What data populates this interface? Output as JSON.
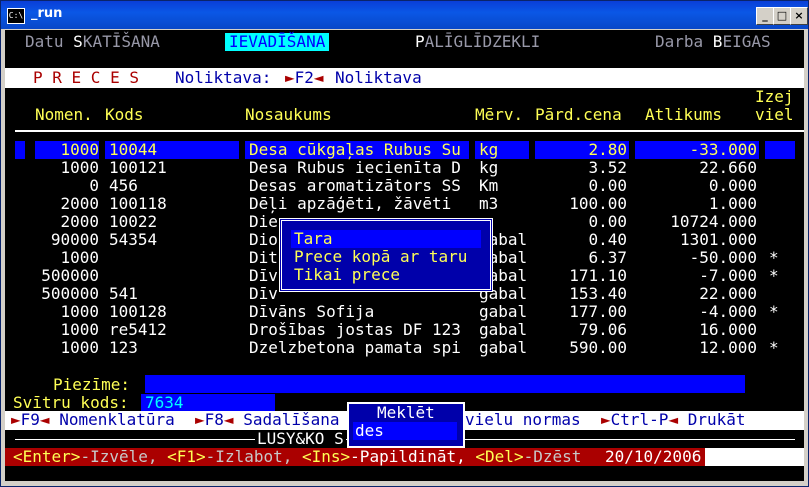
{
  "window": {
    "title": "_run",
    "icon": "command-prompt-icon",
    "minimize": "_",
    "maximize": "□",
    "close": "×"
  },
  "menu": {
    "items": [
      {
        "pre": "Datu ",
        "hot": "S",
        "post": "KATĪŠANA"
      },
      {
        "pre": "",
        "hot": "",
        "post": "IEVADĪŠANA"
      },
      {
        "pre": "",
        "hot": "P",
        "post": "ALĪGLĪDZEKLI"
      },
      {
        "pre": "Darba ",
        "hot": "B",
        "post": "EIGAS"
      }
    ]
  },
  "screen": {
    "title": "P R E C E S",
    "warehouse_label": "Noliktava:",
    "warehouse_key": "F2",
    "warehouse_value": "Noliktava"
  },
  "table": {
    "headers": [
      "Nomen.",
      "Kods",
      "Nosaukums",
      "Mērv.",
      "Pārd.cena",
      "Atlikums",
      "Izej",
      "viel"
    ],
    "rows": [
      {
        "nomen": "1000",
        "kods": "10044",
        "nosaukums": "Desa cūkgaļas Rubus Su",
        "merv": "kg",
        "cena": "2.80",
        "atlikums": "-33.000",
        "izej": ""
      },
      {
        "nomen": "1000",
        "kods": "100121",
        "nosaukums": "Desa Rubus iecienīta D",
        "merv": "kg",
        "cena": "3.52",
        "atlikums": "22.660",
        "izej": ""
      },
      {
        "nomen": "0",
        "kods": "456",
        "nosaukums": "Desas aromatizātors SS",
        "merv": "Km",
        "cena": "0.00",
        "atlikums": "0.000",
        "izej": ""
      },
      {
        "nomen": "2000",
        "kods": "100118",
        "nosaukums": "Dēļi apzāģēti, žāvēti",
        "merv": "m3",
        "cena": "100.00",
        "atlikums": "1.000",
        "izej": ""
      },
      {
        "nomen": "2000",
        "kods": "10022",
        "nosaukums": "Die",
        "merv": "",
        "cena": "0.00",
        "atlikums": "10724.000",
        "izej": ""
      },
      {
        "nomen": "90000",
        "kods": "54354",
        "nosaukums": "Dio",
        "merv": "gabal",
        "cena": "0.40",
        "atlikums": "1301.000",
        "izej": ""
      },
      {
        "nomen": "1000",
        "kods": "",
        "nosaukums": "Dit",
        "merv": "gabal",
        "cena": "6.37",
        "atlikums": "-50.000",
        "izej": "*"
      },
      {
        "nomen": "500000",
        "kods": "",
        "nosaukums": "Dīv",
        "merv": "gabal",
        "cena": "171.10",
        "atlikums": "-7.000",
        "izej": "*"
      },
      {
        "nomen": "500000",
        "kods": "541",
        "nosaukums": "Dīv",
        "merv": "gabal",
        "cena": "153.40",
        "atlikums": "22.000",
        "izej": ""
      },
      {
        "nomen": "1000",
        "kods": "100128",
        "nosaukums": "Dīvāns Sofija",
        "merv": "gabal",
        "cena": "177.00",
        "atlikums": "-4.000",
        "izej": "*"
      },
      {
        "nomen": "1000",
        "kods": "re5412",
        "nosaukums": "Drošības jostas DF 123",
        "merv": "gabal",
        "cena": "79.06",
        "atlikums": "16.000",
        "izej": ""
      },
      {
        "nomen": "1000",
        "kods": "123",
        "nosaukums": "Dzelzbetona pamata spi",
        "merv": "gabal",
        "cena": "590.00",
        "atlikums": "12.000",
        "izej": "*"
      }
    ]
  },
  "popup": {
    "items": [
      "Tara",
      "Prece kopā ar taru",
      "Tikai prece"
    ]
  },
  "footer": {
    "note_label": "Piezīme:",
    "barcode_label": "Svītru kods:",
    "barcode_value": "7634",
    "search_title": "Meklēt",
    "search_value": "des",
    "fkeys": [
      {
        "key": "F9",
        "label": "Nomenklatūra"
      },
      {
        "key": "F8",
        "label": "Sadalīšana"
      },
      {
        "key": "",
        "label": "vielu normas"
      },
      {
        "key": "Ctrl-P",
        "label": "Drukāt"
      }
    ],
    "company": "LUSY&KO S",
    "hints": [
      {
        "key": "<Enter>",
        "label": "-Izvēle, "
      },
      {
        "key": "<F1>",
        "label": "-Izlabot, "
      },
      {
        "key": "<Ins>",
        "label": "-Papildināt, "
      },
      {
        "key": "<Del>",
        "label": "-Dzēst"
      }
    ],
    "date": "20/10/2006"
  },
  "colors": {
    "console_bg": "#000000",
    "blue_bar": "#0000ff",
    "dark_blue": "#0000aa",
    "yellow": "#ffff55",
    "cyan": "#00ffff",
    "red": "#aa0000"
  }
}
